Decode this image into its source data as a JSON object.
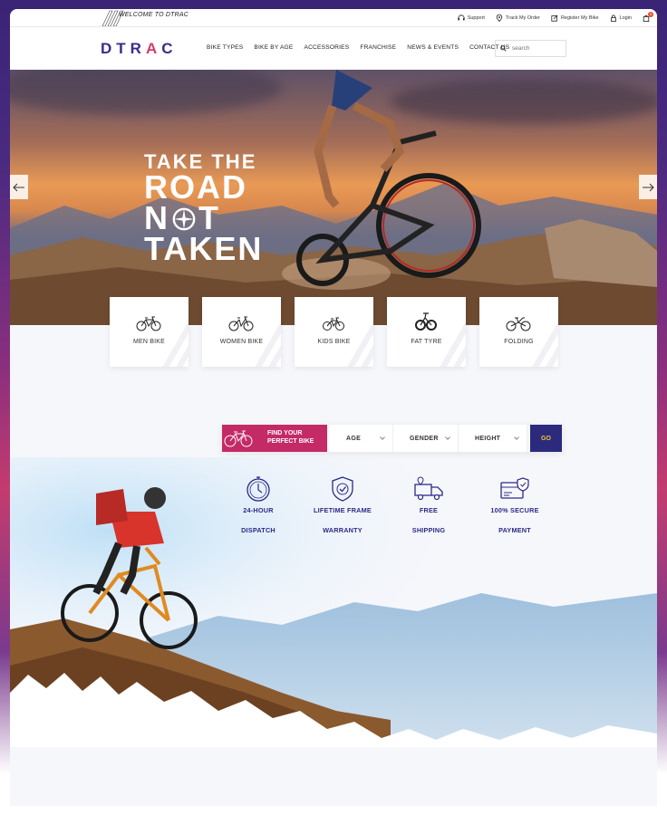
{
  "topbar": {
    "welcome": "WELCOME TO DTRAC",
    "links": [
      {
        "label": "Support",
        "icon": "headset-icon"
      },
      {
        "label": "Track My Order",
        "icon": "location-pin-icon"
      },
      {
        "label": "Register My Bike",
        "icon": "edit-icon"
      },
      {
        "label": "Login",
        "icon": "lock-icon"
      }
    ],
    "cart_count": "3"
  },
  "nav": {
    "logo_parts": [
      "DTR",
      "A",
      "C"
    ],
    "menu": [
      "BIKE TYPES",
      "BIKE BY AGE",
      "ACCESSORIES",
      "FRANCHISE",
      "NEWS & EVENTS",
      "CONTACT US"
    ],
    "search_placeholder": "search"
  },
  "hero": {
    "line1": "TAKE THE",
    "line2": "ROAD",
    "line3_a": "N",
    "line3_b": "T",
    "line4": "TAKEN"
  },
  "categories": [
    "MEN BIKE",
    "WOMEN BIKE",
    "KIDS BIKE",
    "FAT TYRE",
    "FOLDING"
  ],
  "finder": {
    "label_line1": "FIND YOUR",
    "label_line2": "PERFECT BIKE",
    "selects": [
      "AGE",
      "GENDER",
      "HEIGHT"
    ],
    "go": "GO"
  },
  "features": [
    {
      "l1": "24-HOUR",
      "l2": "DISPATCH",
      "icon": "stopwatch-icon"
    },
    {
      "l1": "LIFETIME FRAME",
      "l2": "WARRANTY",
      "icon": "shield-check-icon"
    },
    {
      "l1": "FREE",
      "l2": "SHIPPING",
      "icon": "delivery-truck-icon"
    },
    {
      "l1": "100% SECURE",
      "l2": "PAYMENT",
      "icon": "secure-card-icon"
    }
  ],
  "colors": {
    "brand": "#3b2a8c",
    "accent": "#c32a66",
    "go_text": "#f6c23a"
  }
}
